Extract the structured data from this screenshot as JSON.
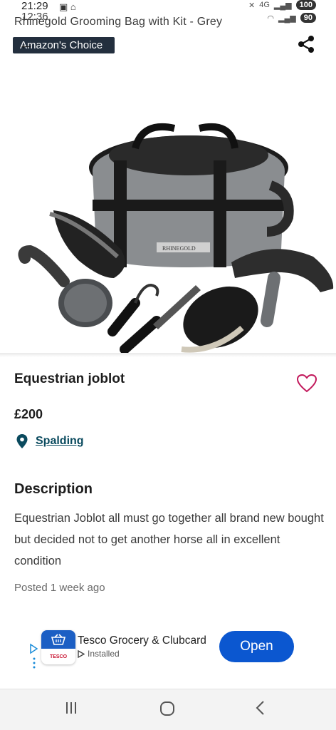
{
  "status_bar": {
    "time_primary": "21:29",
    "time_secondary": "12:36",
    "battery_primary": "100",
    "battery_secondary": "90",
    "network": "4G"
  },
  "amazon_overlay": {
    "product_title": "Rhinegold Grooming Bag with Kit - Grey",
    "badge": "Amazon's Choice"
  },
  "image": {
    "brand_text": "RHINEGOLD"
  },
  "listing": {
    "title": "Equestrian joblot",
    "price": "£200",
    "location": "Spalding"
  },
  "description": {
    "heading": "Description",
    "body": "Equestrian Joblot all must go together  all brand new bought but decided not to get another horse all in excellent condition",
    "posted": "Posted 1 week ago"
  },
  "ad": {
    "app_name": "Tesco Grocery & Clubcard",
    "status": "Installed",
    "logo_text": "TESCO",
    "button": "Open"
  },
  "colors": {
    "accent_blue": "#0b57d0",
    "link_teal": "#0a4a5e",
    "heart_pink": "#c2185b",
    "badge_bg": "#232f3e"
  },
  "icons": [
    "back-arrow-icon",
    "share-icon",
    "heart-icon",
    "location-pin-icon",
    "basket-icon",
    "play-store-icon",
    "recents-icon",
    "home-icon",
    "back-icon"
  ]
}
